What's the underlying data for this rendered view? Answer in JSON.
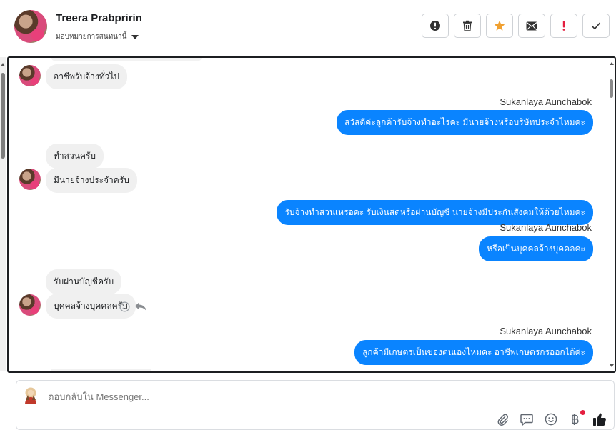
{
  "header": {
    "contact_name": "Treera Prabpririn",
    "assign_label": "มอบหมายการสนทนานี้"
  },
  "actions": [
    {
      "name": "alert-button",
      "icon": "exclamation-circle-icon",
      "color": "#333333"
    },
    {
      "name": "delete-button",
      "icon": "trash-icon",
      "color": "#333333"
    },
    {
      "name": "star-button",
      "icon": "star-icon",
      "color": "#f0a030"
    },
    {
      "name": "mark-unread-button",
      "icon": "envelope-icon",
      "color": "#333333"
    },
    {
      "name": "priority-button",
      "icon": "exclamation-icon",
      "color": "#e41e3f"
    },
    {
      "name": "done-button",
      "icon": "check-icon",
      "color": "#333333"
    }
  ],
  "conversation": {
    "agent_name": "Sukanlaya Aunchabok",
    "messages": [
      {
        "dir": "in",
        "text": "อาชีพรับจ้างทั่วไป"
      },
      {
        "dir": "out",
        "text": "สวัสดีค่ะลูกค้ารับจ้างทำอะไรคะ มีนายจ้างหรือบริษัทประจำไหมคะ"
      },
      {
        "dir": "in",
        "text": "ทำสวนครับ"
      },
      {
        "dir": "in",
        "text": "มีนายจ้างประจำครับ"
      },
      {
        "dir": "out",
        "text": "รับจ้างทำสวนเหรอคะ รับเงินสดหรือผ่านบัญชี นายจ้างมีประกันสังคมให้ด้วยไหมคะ"
      },
      {
        "dir": "out",
        "text": "หรือเป็นบุคคลจ้างบุคคลคะ"
      },
      {
        "dir": "in",
        "text": "รับผ่านบัญชีครับ"
      },
      {
        "dir": "in",
        "text": "บุคคลจ้างบุคคลครับ"
      },
      {
        "dir": "out",
        "text": "ลูกค้ามีเกษตรเป็นของตนเองไหมคะ อาชีพเกษตรกรออกได้ค่ะ"
      }
    ]
  },
  "composer": {
    "placeholder": "ตอบกลับใน Messenger..."
  },
  "colors": {
    "outgoing_bubble": "#0a84ff",
    "incoming_bubble": "#f0f0f0",
    "accent_star": "#f0a030",
    "accent_red": "#e41e3f"
  }
}
